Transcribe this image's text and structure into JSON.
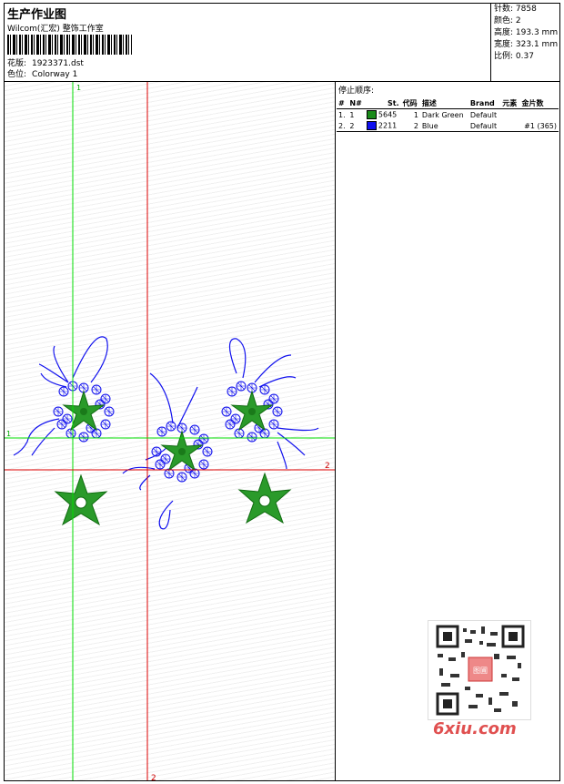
{
  "header": {
    "title": "生产作业图",
    "subtitle": "Wilcom(汇宏) 整饰工作室",
    "design_label": "花版:",
    "design_value": "1923371.dst",
    "colorway_label": "色位:",
    "colorway_value": "Colorway 1"
  },
  "stats": [
    {
      "label": "针数:",
      "value": "7858"
    },
    {
      "label": "颜色:",
      "value": "2"
    },
    {
      "label": "高度:",
      "value": "193.3 mm"
    },
    {
      "label": "宽度:",
      "value": "323.1 mm"
    },
    {
      "label": "比例:",
      "value": "0.37"
    }
  ],
  "stop_sequence": {
    "title": "停止顺序:",
    "columns": [
      "#",
      "N#",
      "St.",
      "代码",
      "描述",
      "Brand",
      "元素",
      "金片数"
    ],
    "rows": [
      {
        "idx": "1.",
        "n": "1",
        "color": "#1a8a1a",
        "st": "5645",
        "code": "1",
        "desc": "Dark Green",
        "brand": "Default",
        "elem": "",
        "seq": ""
      },
      {
        "idx": "2.",
        "n": "2",
        "color": "#1010ee",
        "st": "2211",
        "code": "2",
        "desc": "Blue",
        "brand": "Default",
        "elem": "",
        "seq": "#1 (365)"
      }
    ]
  },
  "guides": {
    "v1": "1",
    "v2": "2",
    "h1": "1",
    "h2": "2"
  },
  "watermark": {
    "qr_label": "图圃",
    "site": "6xiu.com"
  }
}
